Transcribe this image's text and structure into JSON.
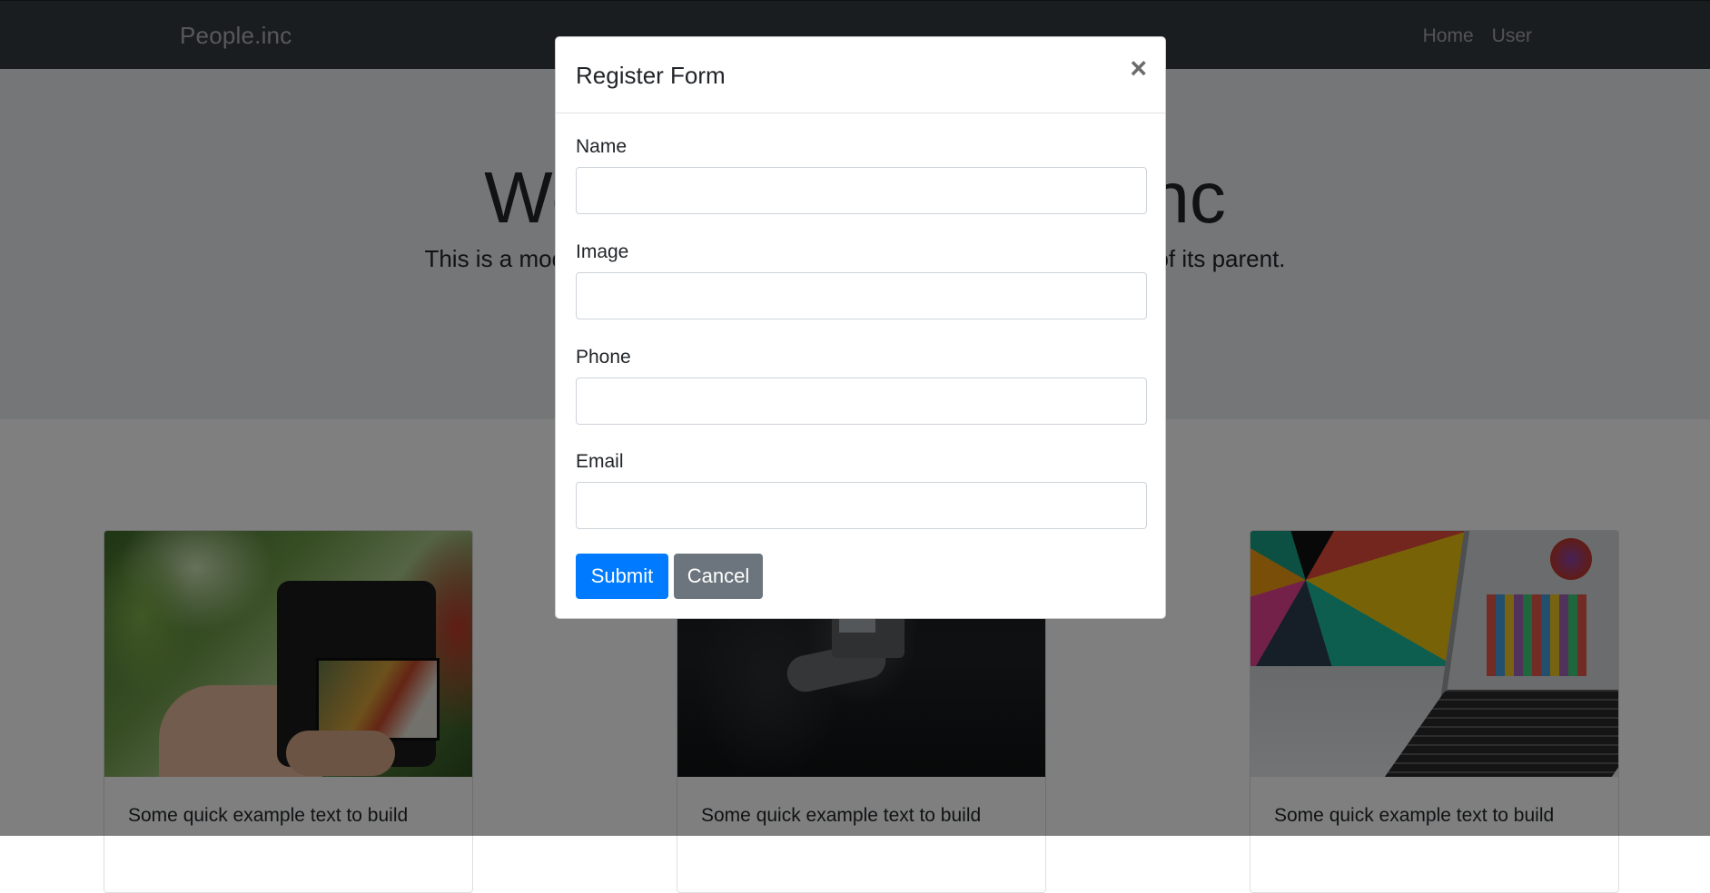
{
  "navbar": {
    "brand": "People.inc",
    "links": [
      "Home",
      "User"
    ]
  },
  "jumbotron": {
    "title": "Welcome to People.inc",
    "lead": "This is a modified jumbotron that occupies the entire horizontal space of its parent."
  },
  "cards": [
    {
      "text": "Some quick example text to build",
      "image": "camera-photo"
    },
    {
      "text": "Some quick example text to build",
      "image": "videographer-photo"
    },
    {
      "text": "Some quick example text to build",
      "image": "laptop-photo"
    }
  ],
  "modal": {
    "title": "Register Form",
    "close_symbol": "×",
    "fields": [
      {
        "label": "Name",
        "value": "",
        "placeholder": ""
      },
      {
        "label": "Image",
        "value": "",
        "placeholder": ""
      },
      {
        "label": "Phone",
        "value": "",
        "placeholder": ""
      },
      {
        "label": "Email",
        "value": "",
        "placeholder": ""
      }
    ],
    "submit_label": "Submit",
    "cancel_label": "Cancel"
  },
  "colors": {
    "navbar_bg": "#343a40",
    "jumbotron_bg": "#e9ecef",
    "primary": "#007bff",
    "secondary": "#6c757d",
    "backdrop": "rgba(0,0,0,0.5)"
  }
}
